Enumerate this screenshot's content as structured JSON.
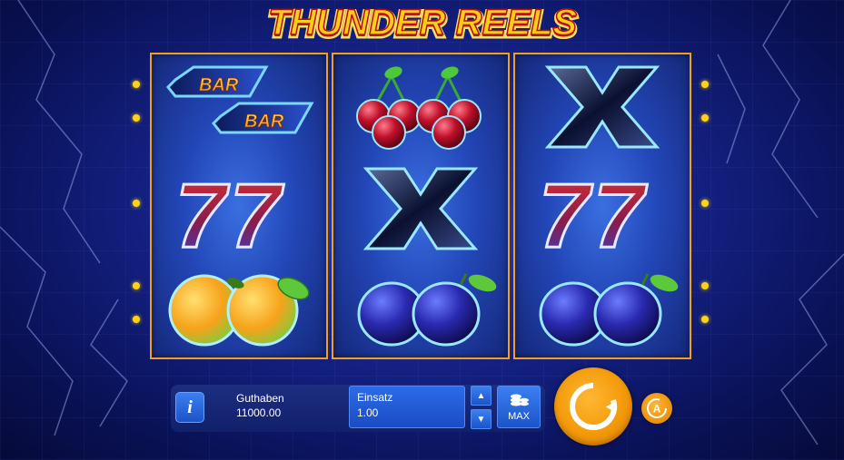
{
  "game": {
    "title": "THUNDER REELS"
  },
  "reels": [
    {
      "symbols": [
        "bar-double",
        "seven-double",
        "orange-double"
      ]
    },
    {
      "symbols": [
        "cherry-double",
        "x-symbol",
        "plum-double"
      ]
    },
    {
      "symbols": [
        "x-symbol",
        "seven-double",
        "plum-double"
      ]
    }
  ],
  "symbol_text": {
    "bar": "BAR",
    "seven": "7"
  },
  "controls": {
    "info_label": "i",
    "balance_label": "Guthaben",
    "balance_value": "11000.00",
    "bet_label": "Einsatz",
    "bet_value": "1.00",
    "bet_up": "▲",
    "bet_down": "▼",
    "max_label": "MAX",
    "auto_label": "A"
  },
  "colors": {
    "accent": "#f39a0a",
    "reel_border": "#f0a020",
    "button_blue": "#2b6be8",
    "payline_dot": "#ffd21a"
  }
}
